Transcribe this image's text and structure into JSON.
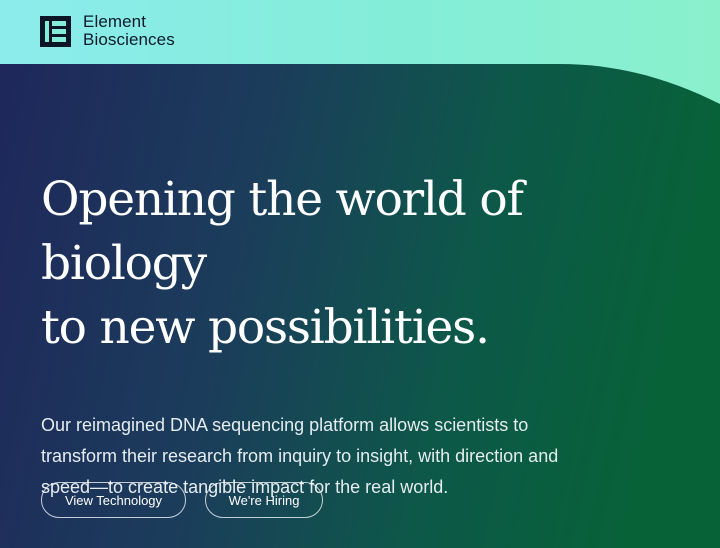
{
  "header": {
    "logo_icon": "element-logo-icon",
    "brand_line1": "Element",
    "brand_line2": "Biosciences"
  },
  "hero": {
    "headline_line1": "Opening the world of biology",
    "headline_line2": "to new possibilities.",
    "description": "Our reimagined DNA sequencing platform allows scientists to transform their research from inquiry to insight, with direction and speed—to create tangible impact for the real world.",
    "primary_button": "View Technology",
    "secondary_button": "We're Hiring"
  },
  "colors": {
    "top_band": "#84edd8",
    "hero_gradient_start": "#1d2a5a",
    "hero_gradient_end": "#0a6040",
    "text": "#ffffff"
  }
}
